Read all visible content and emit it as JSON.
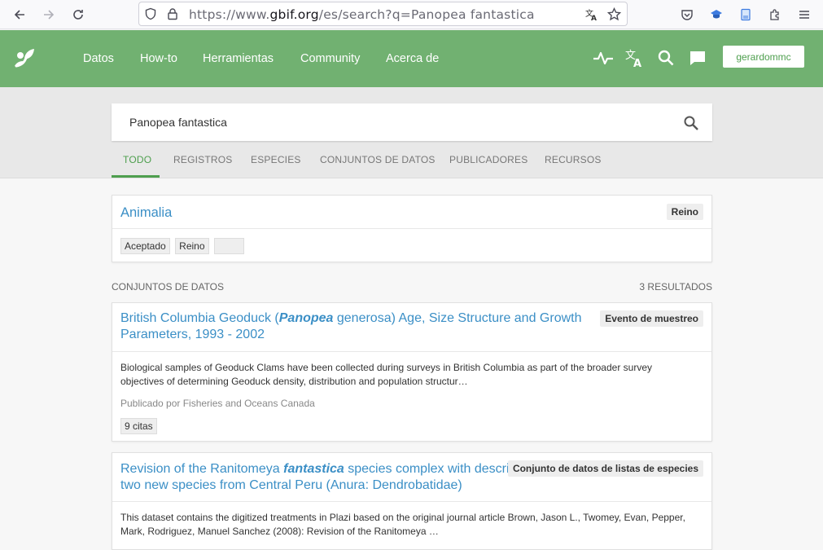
{
  "browser": {
    "url_prefix": "https://www.",
    "url_domain": "gbif.org",
    "url_path": "/es/search?q=Panopea fantastica"
  },
  "nav": {
    "items": [
      "Datos",
      "How-to",
      "Herramientas",
      "Community",
      "Acerca de"
    ],
    "user": "gerardommc"
  },
  "search": {
    "query": "Panopea fantastica",
    "tabs": [
      "TODO",
      "REGISTROS",
      "ESPECIES",
      "CONJUNTOS DE DATOS",
      "PUBLICADORES",
      "RECURSOS"
    ]
  },
  "taxon_card": {
    "title": "Animalia",
    "badge": "Reino",
    "chips": [
      "Aceptado",
      "Reino"
    ]
  },
  "datasets": {
    "heading": "CONJUNTOS DE DATOS",
    "count": "3 RESULTADOS",
    "items": [
      {
        "title_a": "British Columbia Geoduck (",
        "title_em": "Panopea",
        "title_b": " generosa) Age, Size Structure and Growth Parameters, 1993 - 2002",
        "badge": "Evento de muestreo",
        "description": "Biological samples of Geoduck Clams have been collected during surveys in British Columbia as part of the broader survey objectives of determining Geoduck density, distribution and population structur…",
        "publisher": "Publicado por Fisheries and Oceans Canada",
        "citations": "9 citas"
      },
      {
        "title_a": "Revision of the Ranitomeya ",
        "title_em": "fantastica",
        "title_b": " species complex with description of two new species from Central Peru (Anura: Dendrobatidae)",
        "badge": "Conjunto de datos de listas de especies",
        "description": "This dataset contains the digitized treatments in Plazi based on the original journal article Brown, Jason L., Twomey, Evan, Pepper, Mark, Rodriguez, Manuel Sanchez (2008): Revision of the Ranitomeya …"
      }
    ]
  }
}
